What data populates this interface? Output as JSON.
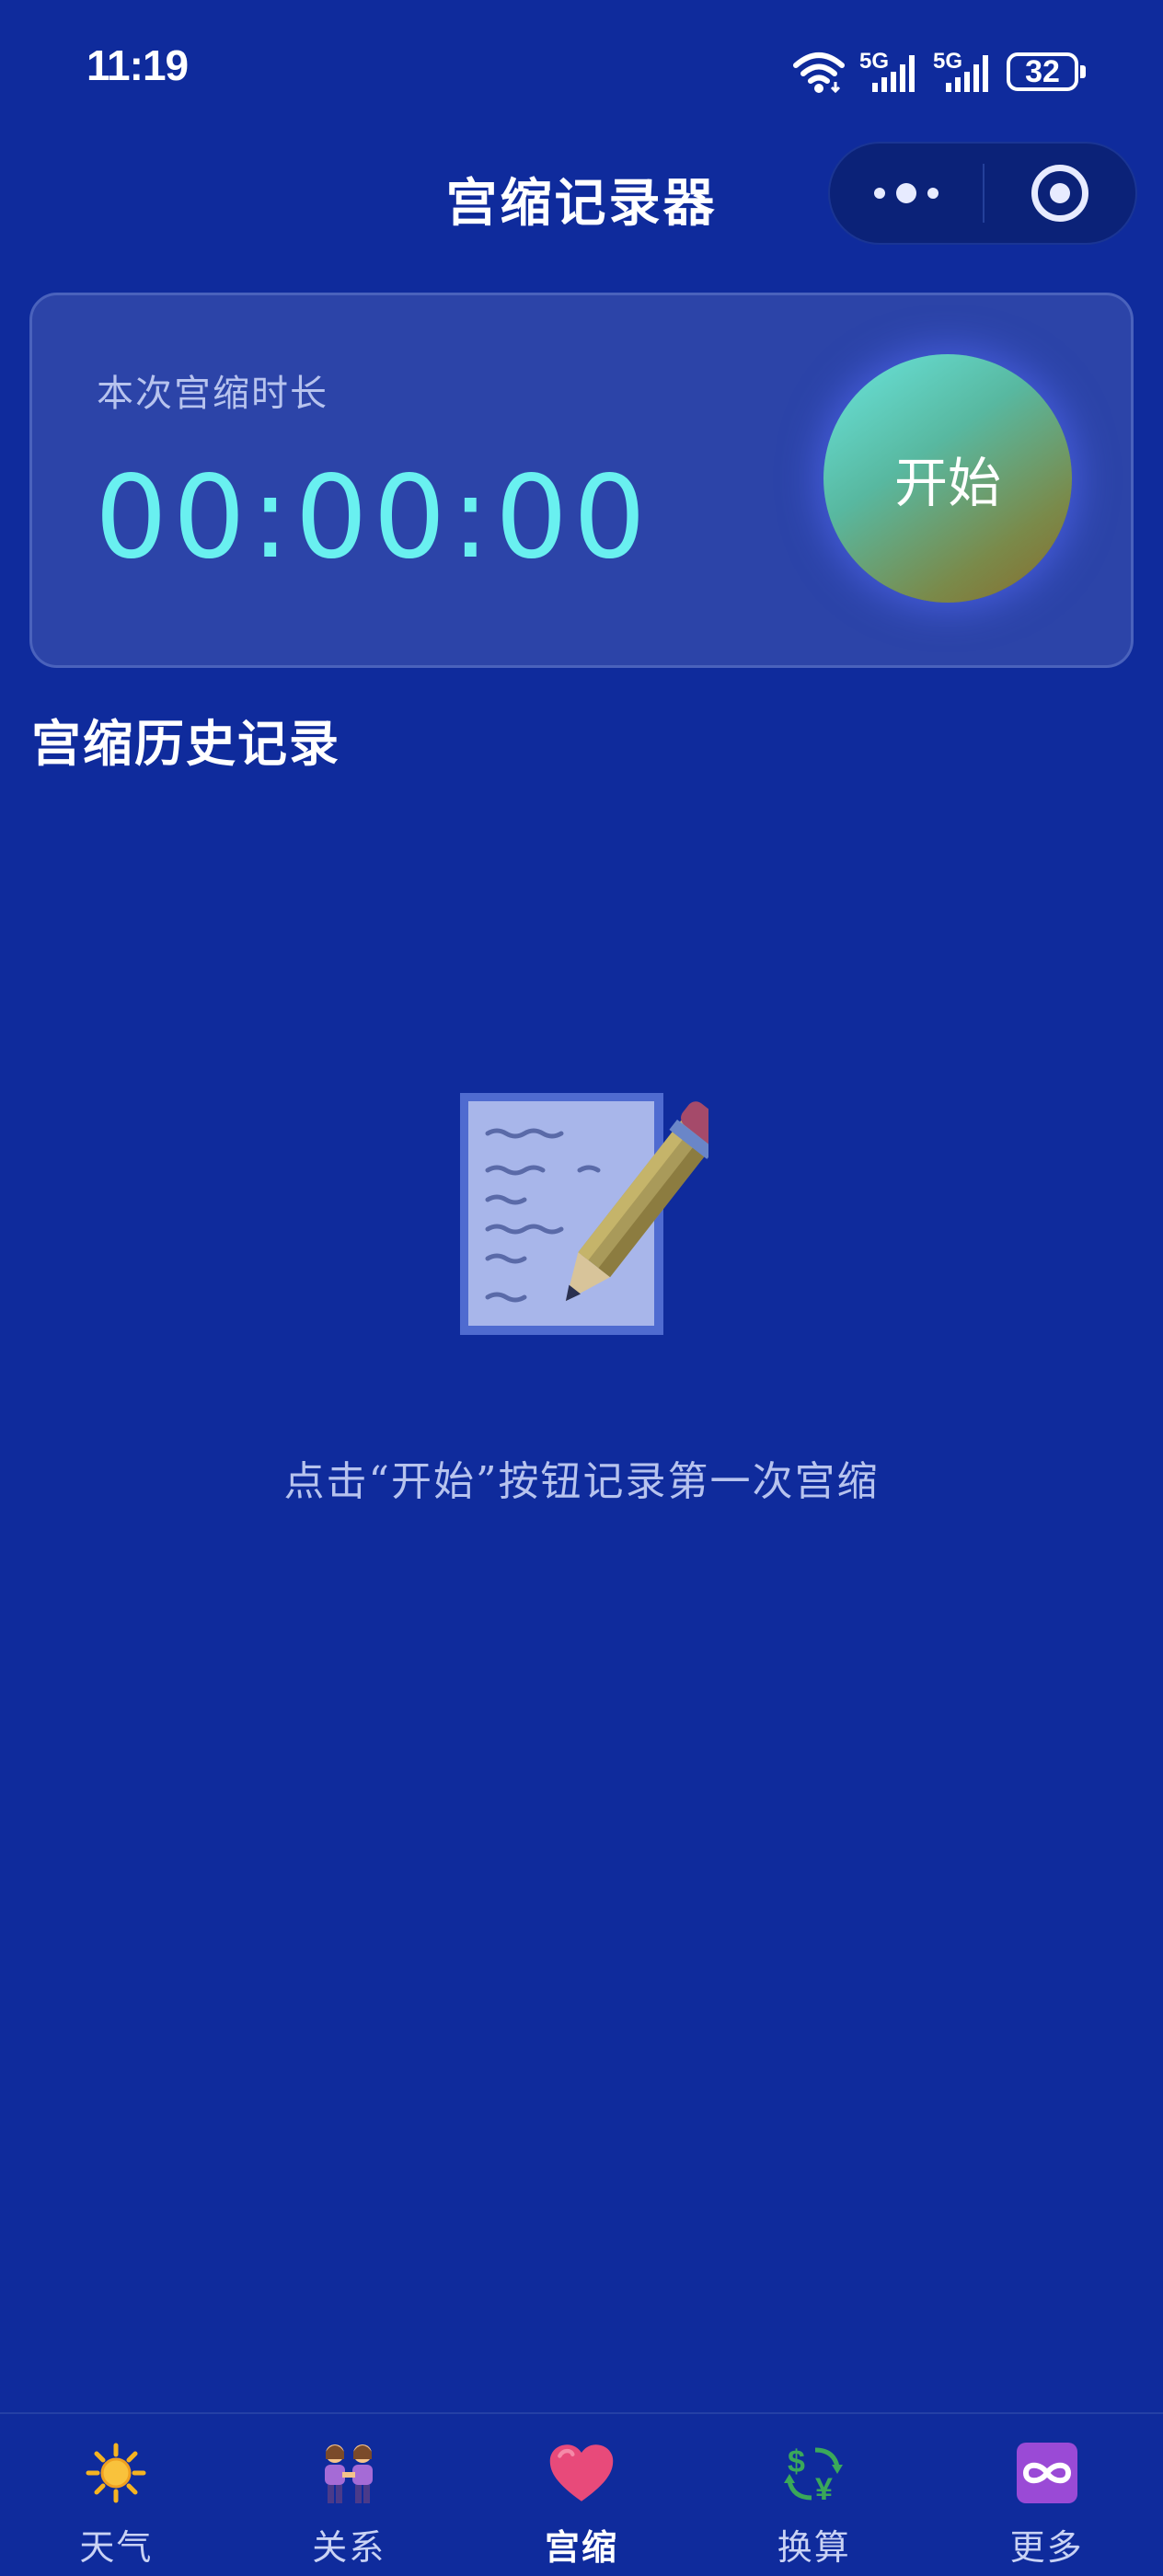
{
  "status_bar": {
    "time": "11:19",
    "network_1": "5G",
    "network_2": "5G",
    "battery": "32"
  },
  "nav": {
    "title": "宫缩记录器"
  },
  "timer": {
    "label": "本次宫缩时长",
    "display": "00:00:00",
    "start_label": "开始"
  },
  "history": {
    "title": "宫缩历史记录",
    "empty_text": "点击“开始”按钮记录第一次宫缩",
    "empty_icon": "memo-pencil-icon"
  },
  "tabs": [
    {
      "label": "天气",
      "icon": "sun-icon",
      "active": false
    },
    {
      "label": "关系",
      "icon": "two-women-icon",
      "active": false
    },
    {
      "label": "宫缩",
      "icon": "heart-icon",
      "active": true
    },
    {
      "label": "换算",
      "icon": "currency-exchange-icon",
      "active": false
    },
    {
      "label": "更多",
      "icon": "infinity-icon",
      "active": false
    }
  ],
  "colors": {
    "background": "#0f2b9c",
    "card": "#2c44a8",
    "timer_digits": "#69f0f0",
    "muted_text": "#b7c3ee"
  }
}
